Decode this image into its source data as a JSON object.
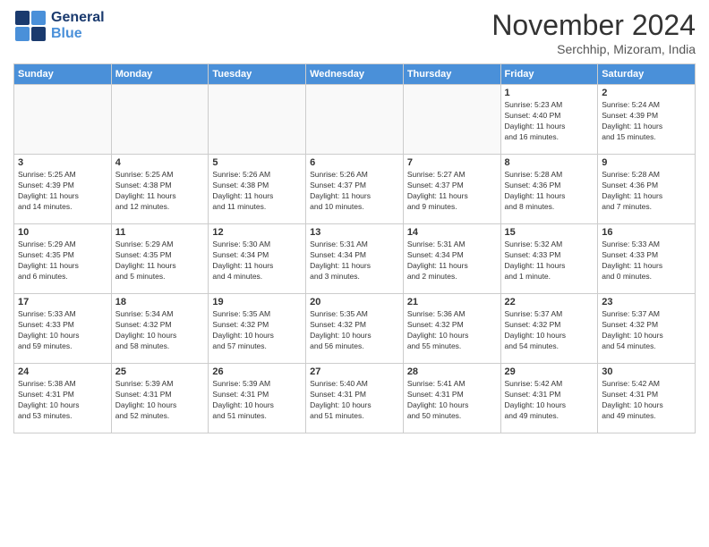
{
  "header": {
    "logo_line1": "General",
    "logo_line2": "Blue",
    "month": "November 2024",
    "location": "Serchhip, Mizoram, India"
  },
  "columns": [
    "Sunday",
    "Monday",
    "Tuesday",
    "Wednesday",
    "Thursday",
    "Friday",
    "Saturday"
  ],
  "weeks": [
    [
      {
        "day": "",
        "info": ""
      },
      {
        "day": "",
        "info": ""
      },
      {
        "day": "",
        "info": ""
      },
      {
        "day": "",
        "info": ""
      },
      {
        "day": "",
        "info": ""
      },
      {
        "day": "1",
        "info": "Sunrise: 5:23 AM\nSunset: 4:40 PM\nDaylight: 11 hours\nand 16 minutes."
      },
      {
        "day": "2",
        "info": "Sunrise: 5:24 AM\nSunset: 4:39 PM\nDaylight: 11 hours\nand 15 minutes."
      }
    ],
    [
      {
        "day": "3",
        "info": "Sunrise: 5:25 AM\nSunset: 4:39 PM\nDaylight: 11 hours\nand 14 minutes."
      },
      {
        "day": "4",
        "info": "Sunrise: 5:25 AM\nSunset: 4:38 PM\nDaylight: 11 hours\nand 12 minutes."
      },
      {
        "day": "5",
        "info": "Sunrise: 5:26 AM\nSunset: 4:38 PM\nDaylight: 11 hours\nand 11 minutes."
      },
      {
        "day": "6",
        "info": "Sunrise: 5:26 AM\nSunset: 4:37 PM\nDaylight: 11 hours\nand 10 minutes."
      },
      {
        "day": "7",
        "info": "Sunrise: 5:27 AM\nSunset: 4:37 PM\nDaylight: 11 hours\nand 9 minutes."
      },
      {
        "day": "8",
        "info": "Sunrise: 5:28 AM\nSunset: 4:36 PM\nDaylight: 11 hours\nand 8 minutes."
      },
      {
        "day": "9",
        "info": "Sunrise: 5:28 AM\nSunset: 4:36 PM\nDaylight: 11 hours\nand 7 minutes."
      }
    ],
    [
      {
        "day": "10",
        "info": "Sunrise: 5:29 AM\nSunset: 4:35 PM\nDaylight: 11 hours\nand 6 minutes."
      },
      {
        "day": "11",
        "info": "Sunrise: 5:29 AM\nSunset: 4:35 PM\nDaylight: 11 hours\nand 5 minutes."
      },
      {
        "day": "12",
        "info": "Sunrise: 5:30 AM\nSunset: 4:34 PM\nDaylight: 11 hours\nand 4 minutes."
      },
      {
        "day": "13",
        "info": "Sunrise: 5:31 AM\nSunset: 4:34 PM\nDaylight: 11 hours\nand 3 minutes."
      },
      {
        "day": "14",
        "info": "Sunrise: 5:31 AM\nSunset: 4:34 PM\nDaylight: 11 hours\nand 2 minutes."
      },
      {
        "day": "15",
        "info": "Sunrise: 5:32 AM\nSunset: 4:33 PM\nDaylight: 11 hours\nand 1 minute."
      },
      {
        "day": "16",
        "info": "Sunrise: 5:33 AM\nSunset: 4:33 PM\nDaylight: 11 hours\nand 0 minutes."
      }
    ],
    [
      {
        "day": "17",
        "info": "Sunrise: 5:33 AM\nSunset: 4:33 PM\nDaylight: 10 hours\nand 59 minutes."
      },
      {
        "day": "18",
        "info": "Sunrise: 5:34 AM\nSunset: 4:32 PM\nDaylight: 10 hours\nand 58 minutes."
      },
      {
        "day": "19",
        "info": "Sunrise: 5:35 AM\nSunset: 4:32 PM\nDaylight: 10 hours\nand 57 minutes."
      },
      {
        "day": "20",
        "info": "Sunrise: 5:35 AM\nSunset: 4:32 PM\nDaylight: 10 hours\nand 56 minutes."
      },
      {
        "day": "21",
        "info": "Sunrise: 5:36 AM\nSunset: 4:32 PM\nDaylight: 10 hours\nand 55 minutes."
      },
      {
        "day": "22",
        "info": "Sunrise: 5:37 AM\nSunset: 4:32 PM\nDaylight: 10 hours\nand 54 minutes."
      },
      {
        "day": "23",
        "info": "Sunrise: 5:37 AM\nSunset: 4:32 PM\nDaylight: 10 hours\nand 54 minutes."
      }
    ],
    [
      {
        "day": "24",
        "info": "Sunrise: 5:38 AM\nSunset: 4:31 PM\nDaylight: 10 hours\nand 53 minutes."
      },
      {
        "day": "25",
        "info": "Sunrise: 5:39 AM\nSunset: 4:31 PM\nDaylight: 10 hours\nand 52 minutes."
      },
      {
        "day": "26",
        "info": "Sunrise: 5:39 AM\nSunset: 4:31 PM\nDaylight: 10 hours\nand 51 minutes."
      },
      {
        "day": "27",
        "info": "Sunrise: 5:40 AM\nSunset: 4:31 PM\nDaylight: 10 hours\nand 51 minutes."
      },
      {
        "day": "28",
        "info": "Sunrise: 5:41 AM\nSunset: 4:31 PM\nDaylight: 10 hours\nand 50 minutes."
      },
      {
        "day": "29",
        "info": "Sunrise: 5:42 AM\nSunset: 4:31 PM\nDaylight: 10 hours\nand 49 minutes."
      },
      {
        "day": "30",
        "info": "Sunrise: 5:42 AM\nSunset: 4:31 PM\nDaylight: 10 hours\nand 49 minutes."
      }
    ]
  ]
}
